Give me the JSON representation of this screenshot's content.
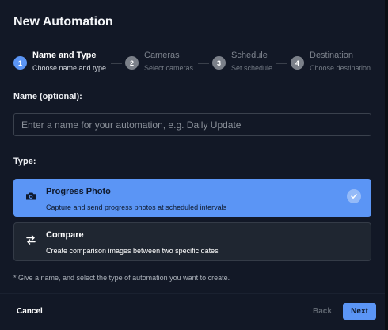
{
  "dialog": {
    "title": "New Automation"
  },
  "steps": [
    {
      "num": "1",
      "label": "Name and Type",
      "sub": "Choose name and type",
      "active": true
    },
    {
      "num": "2",
      "label": "Cameras",
      "sub": "Select cameras",
      "active": false
    },
    {
      "num": "3",
      "label": "Schedule",
      "sub": "Set schedule",
      "active": false
    },
    {
      "num": "4",
      "label": "Destination",
      "sub": "Choose destination",
      "active": false
    }
  ],
  "name_field": {
    "label": "Name (optional):",
    "value": "",
    "placeholder": "Enter a name for your automation, e.g. Daily Update"
  },
  "type_section": {
    "label": "Type:",
    "options": [
      {
        "title": "Progress Photo",
        "description": "Capture and send progress photos at scheduled intervals",
        "icon": "camera-icon",
        "selected": true
      },
      {
        "title": "Compare",
        "description": "Create comparison images between two specific dates",
        "icon": "compare-arrows-icon",
        "selected": false
      }
    ]
  },
  "hint": "* Give a name, and select the type of automation you want to create.",
  "footer": {
    "cancel": "Cancel",
    "back": "Back",
    "next": "Next"
  },
  "colors": {
    "accent": "#5b95f5",
    "background": "#121826",
    "card": "#1f2631"
  }
}
